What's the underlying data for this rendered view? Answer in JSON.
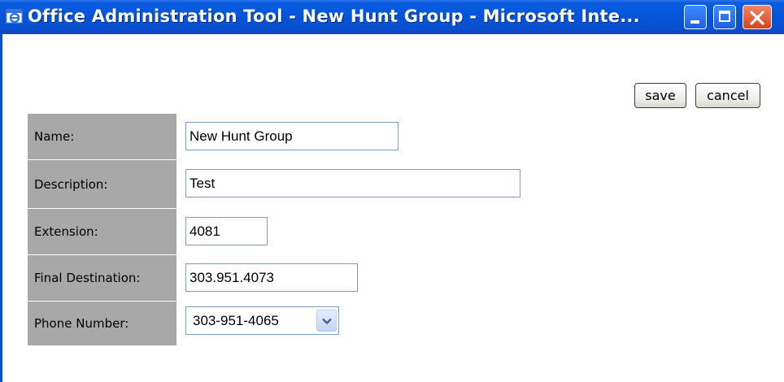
{
  "window": {
    "title": "Office Administration Tool - New Hunt Group - Microsoft Inte...",
    "titlebar_color": "#0554d8"
  },
  "toolbar": {
    "save_label": "save",
    "cancel_label": "cancel"
  },
  "form": {
    "rows": [
      {
        "label": "Name:",
        "value": "New Hunt Group"
      },
      {
        "label": "Description:",
        "value": "Test"
      },
      {
        "label": "Extension:",
        "value": "4081"
      },
      {
        "label": "Final Destination:",
        "value": "303.951.4073"
      },
      {
        "label": "Phone Number:",
        "value": "303-951-4065"
      }
    ],
    "label_bg": "#a8a8a8"
  },
  "icons": {
    "app": "ie-window-icon",
    "minimize": "minimize-icon",
    "maximize": "maximize-icon",
    "close": "close-icon",
    "dropdown": "chevron-down-icon"
  }
}
